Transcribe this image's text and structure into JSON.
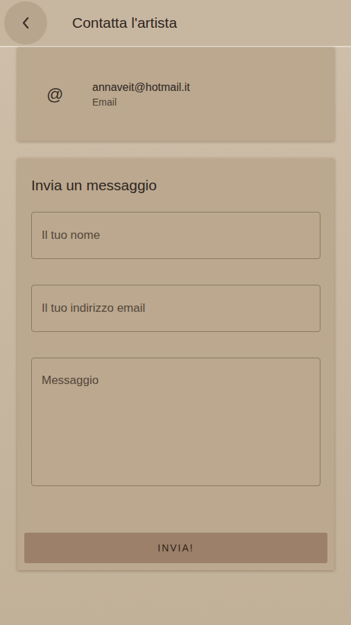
{
  "header": {
    "title": "Contatta l'artista"
  },
  "contact": {
    "icon": "@",
    "value": "annaveit@hotmail.it",
    "label": "Email"
  },
  "form": {
    "title": "Invia un messaggio",
    "fields": [
      {
        "placeholder": "Il tuo nome",
        "kind": "input"
      },
      {
        "placeholder": "Il tuo indirizzo email",
        "kind": "input"
      },
      {
        "placeholder": "Messaggio",
        "kind": "textarea"
      }
    ],
    "button": "INVIA!"
  }
}
